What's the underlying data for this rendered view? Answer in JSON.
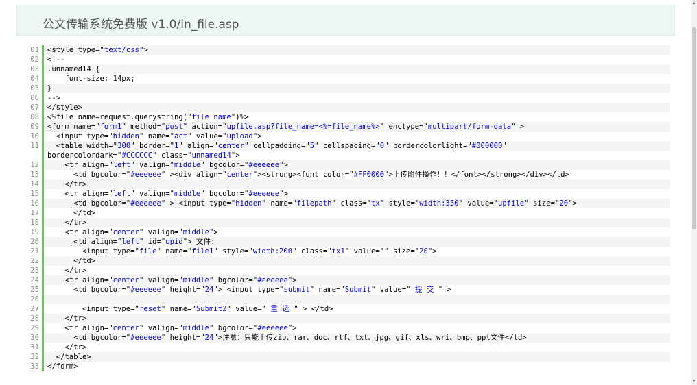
{
  "header": {
    "title": "公文传输系统免费版 v1.0/in_file.asp"
  },
  "code_lines": [
    {
      "n": "01",
      "t": "<style type=\"text/css\">"
    },
    {
      "n": "02",
      "t": "<!--"
    },
    {
      "n": "03",
      "t": ".unnamed14 {"
    },
    {
      "n": "04",
      "t": "    font-size: 14px;"
    },
    {
      "n": "05",
      "t": "}"
    },
    {
      "n": "06",
      "t": "-->"
    },
    {
      "n": "07",
      "t": "</style>"
    },
    {
      "n": "08",
      "t": "<%file_name=request.querystring(\"file_name\")%>"
    },
    {
      "n": "09",
      "t": "<form name=\"form1\" method=\"post\" action=\"upfile.asp?file_name=<%=file_name%>\" enctype=\"multipart/form-data\" >"
    },
    {
      "n": "10",
      "t": "  <input type=\"hidden\" name=\"act\" value=\"upload\">"
    },
    {
      "n": "11",
      "t": "  <table width=\"300\" border=\"1\" align=\"center\" cellpadding=\"5\" cellspacing=\"0\" bordercolorlight=\"#000000\""
    },
    {
      "n": "",
      "t": "bordercolordark=\"#CCCCCC\" class=\"unnamed14\">"
    },
    {
      "n": "12",
      "t": "    <tr align=\"left\" valign=\"middle\" bgcolor=\"#eeeeee\">"
    },
    {
      "n": "13",
      "t": "      <td bgcolor=\"#eeeeee\" ><div align=\"center\"><strong><font color=\"#FF0000\">上传附件操作！！</font></strong></div></td>"
    },
    {
      "n": "14",
      "t": "    </tr>"
    },
    {
      "n": "15",
      "t": "    <tr align=\"left\" valign=\"middle\" bgcolor=\"#eeeeee\">"
    },
    {
      "n": "16",
      "t": "      <td bgcolor=\"#eeeeee\" > <input type=\"hidden\" name=\"filepath\" class=\"tx\" style=\"width:350\" value=\"upfile\" size=\"20\">"
    },
    {
      "n": "17",
      "t": "      </td>"
    },
    {
      "n": "18",
      "t": "    </tr>"
    },
    {
      "n": "19",
      "t": "    <tr align=\"center\" valign=\"middle\">"
    },
    {
      "n": "20",
      "t": "      <td align=\"left\" id=\"upid\"> 文件:"
    },
    {
      "n": "21",
      "t": "        <input type=\"file\" name=\"file1\" style=\"width:200\" class=\"tx1\" value=\"\" size=\"20\">"
    },
    {
      "n": "22",
      "t": "      </td>"
    },
    {
      "n": "23",
      "t": "    </tr>"
    },
    {
      "n": "24",
      "t": "    <tr align=\"center\" valign=\"middle\" bgcolor=\"#eeeeee\">"
    },
    {
      "n": "25",
      "t": "      <td bgcolor=\"#eeeeee\" height=\"24\"> <input type=\"submit\" name=\"Submit\" value=\" 提 交 \" >"
    },
    {
      "n": "26",
      "t": ""
    },
    {
      "n": "27",
      "t": "        <input type=\"reset\" name=\"Submit2\" value=\" 重 选 \" > </td>"
    },
    {
      "n": "28",
      "t": "    </tr>"
    },
    {
      "n": "29",
      "t": "    <tr align=\"center\" valign=\"middle\" bgcolor=\"#eeeeee\">"
    },
    {
      "n": "30",
      "t": "      <td bgcolor=\"#eeeeee\" height=\"24\">注意：只能上传zip、rar、doc、rtf、txt、jpg、gif、xls、wri、bmp、ppt文件</td>"
    },
    {
      "n": "31",
      "t": "    </tr>"
    },
    {
      "n": "32",
      "t": "  </table>"
    },
    {
      "n": "33",
      "t": "</form>"
    }
  ],
  "colors": {
    "header_bg": "#ecf7f6",
    "gutter_bar": "#6fc65f",
    "attr_value": "#0000dd",
    "line_number": "#8a8a8a"
  }
}
